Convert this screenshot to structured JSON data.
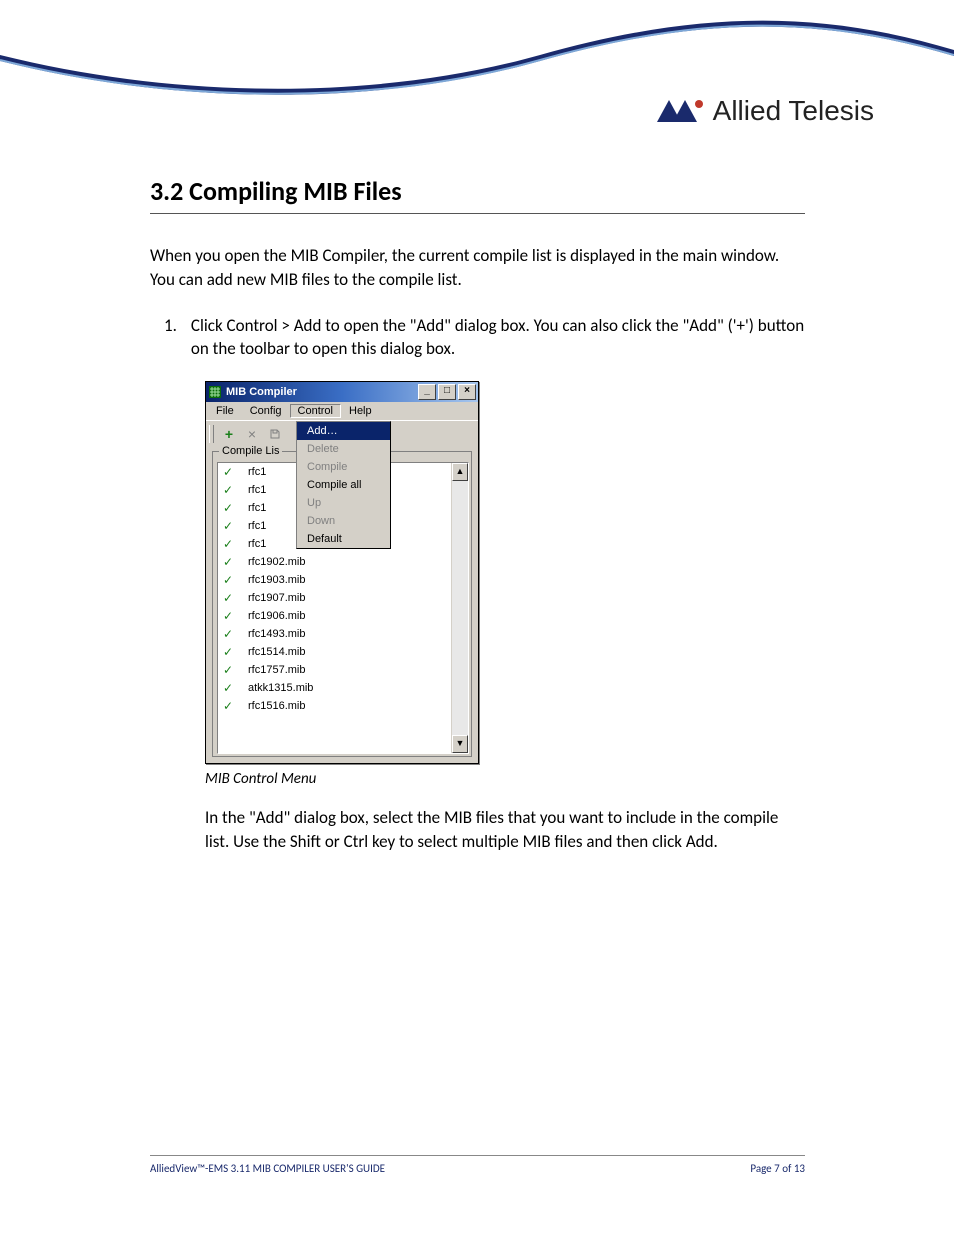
{
  "brand_name": "Allied Telesis",
  "section_heading": "3.2 Compiling MIB Files",
  "intro_paragraph": "When you open the MIB Compiler, the current compile list is displayed in the main window. You can add new MIB files to the compile list.",
  "step_number": "1.",
  "step_text": "Click Control > Add to open the \"Add\" dialog box. You can also click the \"Add\" ('+') button on the toolbar to open this dialog box.",
  "caption": "MIB Control Menu",
  "after_paragraph": "In the \"Add\" dialog box, select the MIB files that you want to include in the compile list. Use the Shift or Ctrl key to select multiple MIB files and then click Add.",
  "window": {
    "title": "MIB Compiler",
    "menubar": [
      "File",
      "Config",
      "Control",
      "Help"
    ],
    "open_menu_index": 2,
    "toolbar_icons": [
      "add-icon",
      "delete-icon",
      "compile-icon"
    ],
    "dropdown": [
      {
        "label": "Add…",
        "state": "selected"
      },
      {
        "label": "Delete",
        "state": "disabled"
      },
      {
        "label": "Compile",
        "state": "disabled"
      },
      {
        "label": "Compile all",
        "state": "normal"
      },
      {
        "label": "Up",
        "state": "disabled"
      },
      {
        "label": "Down",
        "state": "disabled"
      },
      {
        "label": "Default",
        "state": "normal"
      }
    ],
    "list_legend": "Compile Lis",
    "list_items": [
      "rfc1",
      "rfc1",
      "rfc1",
      "rfc1",
      "rfc1",
      "rfc1902.mib",
      "rfc1903.mib",
      "rfc1907.mib",
      "rfc1906.mib",
      "rfc1493.mib",
      "rfc1514.mib",
      "rfc1757.mib",
      "atkk1315.mib",
      "rfc1516.mib"
    ]
  },
  "footer_left": "AlliedView™-EMS 3.11 MIB COMPILER USER'S GUIDE",
  "footer_right": "Page 7 of 13"
}
